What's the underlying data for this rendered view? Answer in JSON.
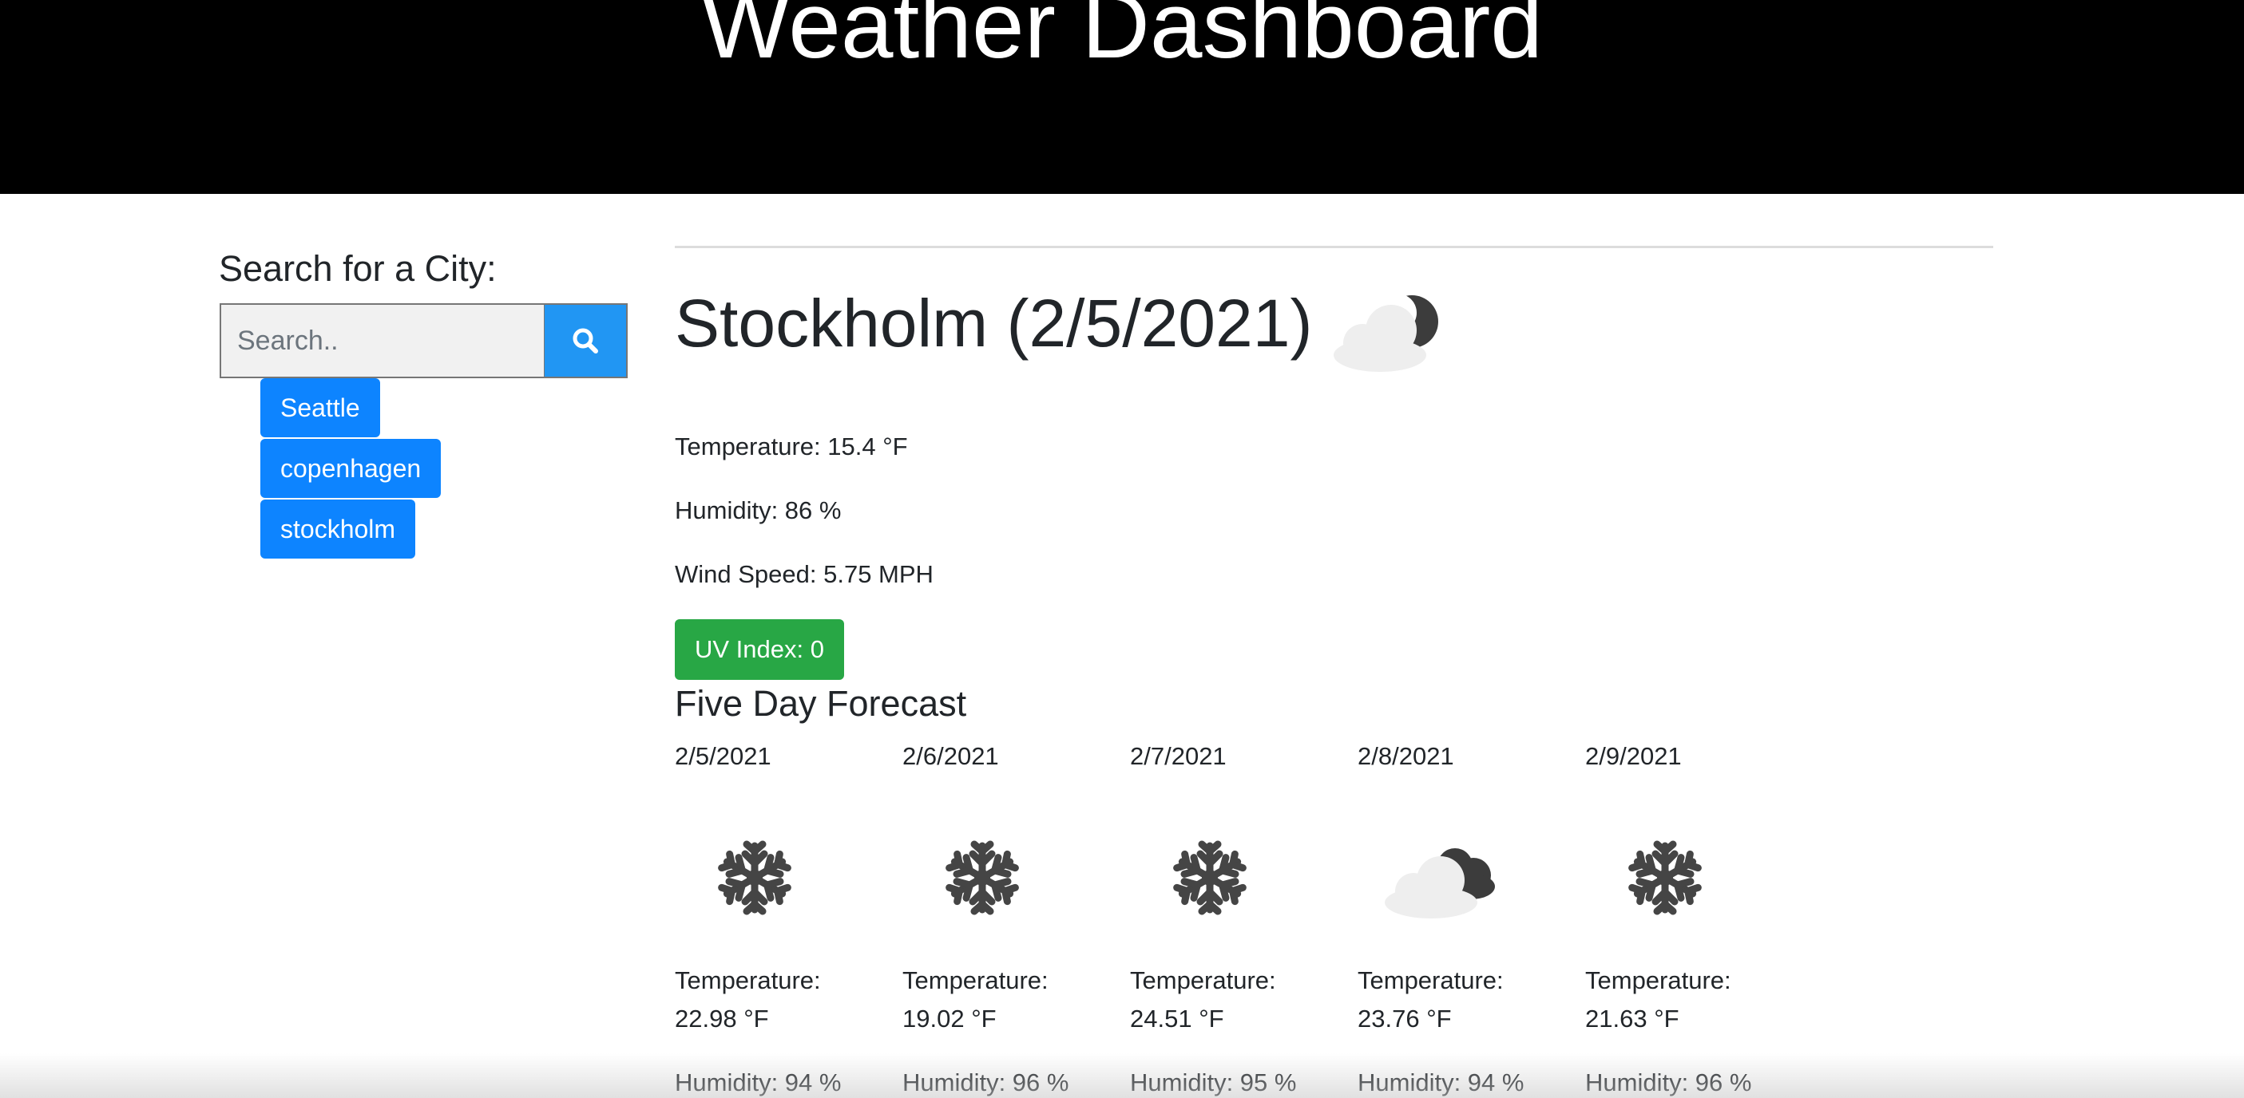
{
  "header": {
    "title": "Weather Dashboard"
  },
  "sidebar": {
    "heading": "Search for a City:",
    "search": {
      "placeholder": "Search..",
      "value": ""
    },
    "search_button_icon": "search-icon",
    "history": [
      "Seattle",
      "copenhagen",
      "stockholm"
    ]
  },
  "current": {
    "title": "Stockholm (2/5/2021)",
    "icon": "partly-cloudy-night-icon",
    "temperature": "Temperature: 15.4 °F",
    "humidity": "Humidity: 86 %",
    "wind": "Wind Speed: 5.75 MPH",
    "uv": "UV Index: 0"
  },
  "forecast": {
    "heading": "Five Day Forecast",
    "temp_label": "Temperature:",
    "days": [
      {
        "date": "2/5/2021",
        "icon": "snowflake-icon",
        "temp": "22.98 °F",
        "humidity": "Humidity: 94 %"
      },
      {
        "date": "2/6/2021",
        "icon": "snowflake-icon",
        "temp": "19.02 °F",
        "humidity": "Humidity: 96 %"
      },
      {
        "date": "2/7/2021",
        "icon": "snowflake-icon",
        "temp": "24.51 °F",
        "humidity": "Humidity: 95 %"
      },
      {
        "date": "2/8/2021",
        "icon": "cloudy-icon",
        "temp": "23.76 °F",
        "humidity": "Humidity: 94 %"
      },
      {
        "date": "2/9/2021",
        "icon": "snowflake-icon",
        "temp": "21.63 °F",
        "humidity": "Humidity: 96 %"
      }
    ]
  },
  "colors": {
    "header_bg": "#000000",
    "search_button": "#2196f3",
    "history_button": "#0d84ff",
    "uv_badge": "#28a745"
  }
}
